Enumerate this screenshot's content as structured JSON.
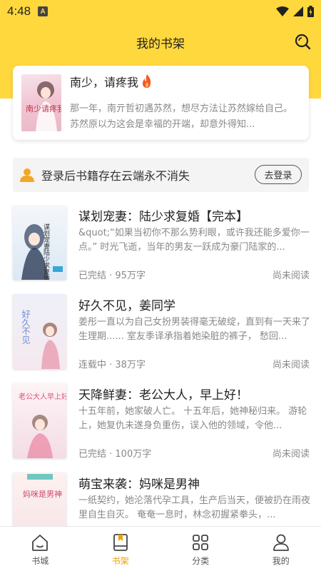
{
  "status": {
    "time": "4:48",
    "indicator": "A"
  },
  "header": {
    "title": "我的书架"
  },
  "featured": {
    "title": "南少，请疼我",
    "cover_text": "南少请疼我",
    "description": "那一年，南亓哲初遇苏然，想尽方法让苏然嫁给自己。 苏然原以为这会是幸福的开端，却意外得知..."
  },
  "login": {
    "text": "登录后书籍存在云端永不消失",
    "button": "去登录"
  },
  "books": [
    {
      "title": "谋划宠妻：陆少求复婚【完本】",
      "description": "&quot;“如果当初你不那么势利眼，或许我还能多爱你一点。” 时光飞逝，当年的男友一跃成为豪门陆家的...",
      "meta": "已完结 · 95万字",
      "read": "尚未阅读",
      "cover_text": "谋划宠妻陆少求复婚"
    },
    {
      "title": "好久不见，姜同学",
      "description": "姜彤一直以为自己女扮男装得毫无破绽，直到有一天来了生理期...... 室友季译承指着她染脏的裤子， 愁回...",
      "meta": "连载中 · 38万字",
      "read": "尚未阅读",
      "cover_text": "好久不见"
    },
    {
      "title": "天降鲜妻：老公大人，早上好！",
      "description": "十五年前，她家破人亡。 十五年后，她神秘归来。 游轮上，她复仇未遂身负重伤，误入他的领域，令他...",
      "meta": "已完结 · 100万字",
      "read": "尚未阅读",
      "cover_text": "老公大人早上好"
    },
    {
      "title": "萌宝来袭：妈咪是男神",
      "description": "一纸契约，她沦落代孕工具，生产后当天，便被扔在雨夜里自生自灭。 奄奄一息时，林念初握紧拳头，...",
      "meta": "",
      "read": "",
      "cover_text": "妈咪是男神"
    }
  ],
  "tabs": [
    {
      "label": "书城",
      "icon": "home-icon"
    },
    {
      "label": "书架",
      "icon": "bookshelf-icon"
    },
    {
      "label": "分类",
      "icon": "category-grid-icon"
    },
    {
      "label": "我的",
      "icon": "profile-icon"
    }
  ],
  "colors": {
    "brand_yellow": "#FFD83D",
    "active_tab": "#F0A000",
    "user_icon": "#F5A623",
    "flame": "#F25A2A"
  }
}
